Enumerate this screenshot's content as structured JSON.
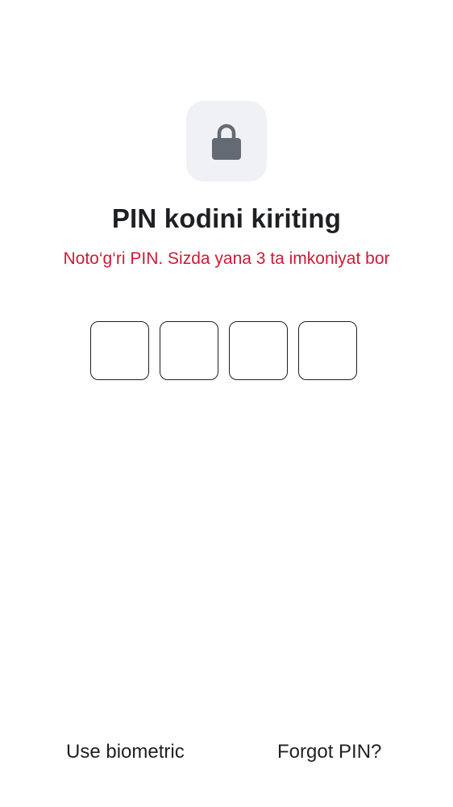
{
  "lock": {
    "icon": "lock-icon",
    "tile_color": "#eff1f5",
    "icon_color": "#646a73"
  },
  "title": "PIN kodini kiriting",
  "error": {
    "text": "Noto‘g‘ri PIN. Sizda yana 3 ta imkoniyat bor",
    "color": "#cd1b35"
  },
  "pin": {
    "digits": [
      "",
      "",
      "",
      ""
    ]
  },
  "actions": {
    "biometric_label": "Use biometric",
    "forgot_label": "Forgot PIN?"
  }
}
